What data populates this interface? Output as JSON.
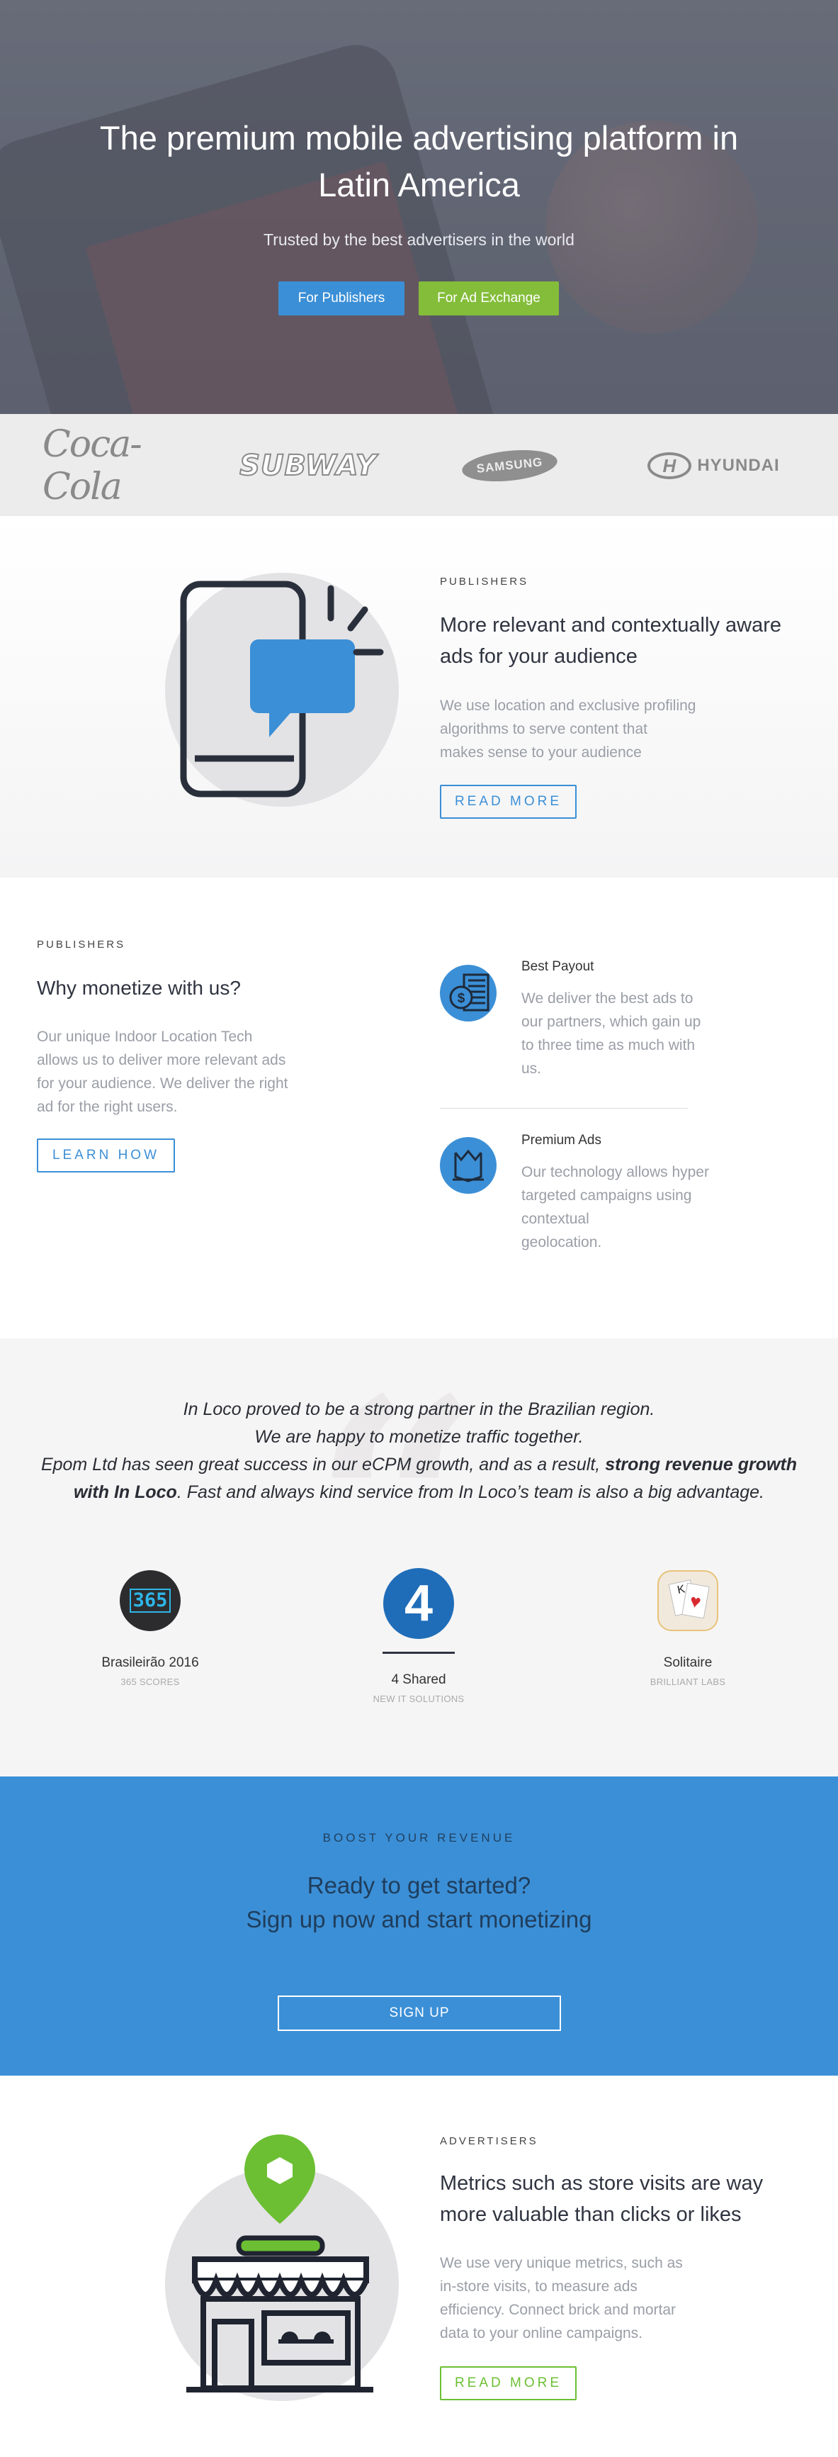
{
  "hero": {
    "title_line1": "The premium mobile advertising platform in",
    "title_line2": "Latin America",
    "subtitle": "Trusted by the best advertisers in the world",
    "btn_publishers": "For Publishers",
    "btn_adexchange": "For Ad Exchange"
  },
  "logos": {
    "coke": "Coca-Cola",
    "subway": "SUBWAY",
    "samsung": "SAMSUNG",
    "hyundai": "HYUNDAI"
  },
  "publishers": {
    "eyebrow": "PUBLISHERS",
    "title_line1": "More relevant and contextually aware",
    "title_line2": "ads for your audience",
    "body": [
      "We use location and exclusive profiling",
      "algorithms to serve content that",
      "makes sense to your audience"
    ],
    "button": "READ MORE"
  },
  "monetize": {
    "eyebrow": "PUBLISHERS",
    "title": "Why monetize with us?",
    "body": [
      "Our unique Indoor Location Tech",
      "allows us to deliver more relevant ads",
      "for your audience. We deliver the right",
      "ad for the right users."
    ],
    "button": "LEARN HOW",
    "features": [
      {
        "title": "Best Payout",
        "body": [
          "We deliver the best ads to",
          "our partners, which gain up",
          "to three time as much with",
          "us."
        ]
      },
      {
        "title": "Premium Ads",
        "body": [
          "Our technology allows hyper",
          "targeted campaigns using",
          "contextual",
          "geolocation."
        ]
      }
    ]
  },
  "testimonial": {
    "line1": "In Loco proved to be a strong partner in the Brazilian region.",
    "line2": "We are happy to monetize traffic together.",
    "line3_a": "Epom Ltd has seen great success in our eCPM growth, and as a result, ",
    "line3_b": "strong revenue growth",
    "line4_a": "with In Loco",
    "line4_b": ". Fast and always kind service from In Loco’s team is also a big advantage.",
    "clients": [
      {
        "name": "Brasileirão 2016",
        "sub": "365 SCORES",
        "badge": "365"
      },
      {
        "name": "4 Shared",
        "sub": "NEW IT SOLUTIONS",
        "badge": "4"
      },
      {
        "name": "Solitaire",
        "sub": "BRILLIANT LABS",
        "badge": ""
      }
    ]
  },
  "cta": {
    "eyebrow": "BOOST YOUR REVENUE",
    "title_line1": "Ready to get started?",
    "title_line2": "Sign up now and start monetizing",
    "button": "SIGN UP"
  },
  "advertisers": {
    "eyebrow": "ADVERTISERS",
    "title_line1": "Metrics such as store visits are way",
    "title_line2": "more valuable than clicks or likes",
    "body": [
      "We use very unique metrics, such as",
      "in-store visits, to measure ads",
      "efficiency. Connect brick and mortar",
      "data to your online campaigns."
    ],
    "button": "READ MORE"
  },
  "colors": {
    "brand_blue": "#3b8fd6",
    "brand_green": "#84bd3a",
    "dark_navy": "#2f3440"
  },
  "icons": [
    "phone-chat-icon",
    "money-stack-icon",
    "premium-book-icon",
    "store-pin-icon"
  ]
}
